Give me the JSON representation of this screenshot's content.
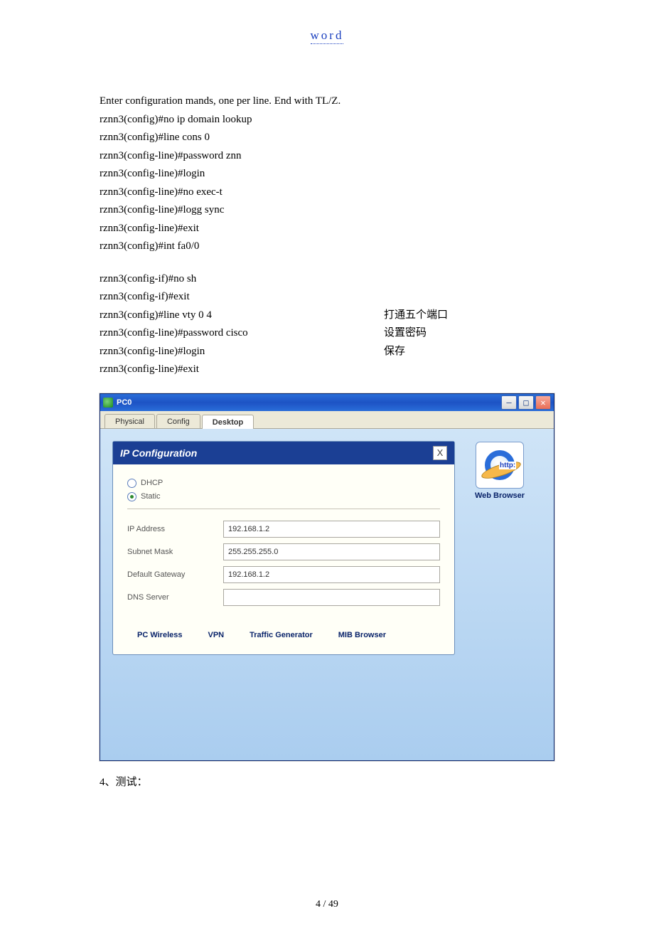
{
  "header": {
    "link_text": "word"
  },
  "cli": {
    "line1": "Enter configuration mands, one per line.    End with TL/Z.",
    "line2": "rznn3(config)#no ip domain lookup",
    "line3": "rznn3(config)#line cons 0",
    "line4": "rznn3(config-line)#password znn",
    "line5": "rznn3(config-line)#login",
    "line6": "rznn3(config-line)#no exec-t",
    "line7": "rznn3(config-line)#logg sync",
    "line8": "rznn3(config-line)#exit",
    "line9": "rznn3(config)#int fa0/0",
    "line10": "rznn3(config-if)#no sh",
    "line11": "rznn3(config-if)#exit",
    "line12": "rznn3(config)#line vty 0 4",
    "line13": "rznn3(config-line)#password cisco",
    "line14": "rznn3(config-line)#login",
    "line15": "rznn3(config-line)#exit",
    "note12": "打通五个端口",
    "note13": "设置密码",
    "note14": "保存"
  },
  "pc0": {
    "title": "PC0",
    "tabs": {
      "physical": "Physical",
      "config": "Config",
      "desktop": "Desktop"
    },
    "ipconf": {
      "title": "IP Configuration",
      "close": "X",
      "dhcp": "DHCP",
      "static": "Static",
      "ip_label": "IP Address",
      "ip_value": "192.168.1.2",
      "mask_label": "Subnet Mask",
      "mask_value": "255.255.255.0",
      "gw_label": "Default Gateway",
      "gw_value": "192.168.1.2",
      "dns_label": "DNS Server",
      "dns_value": ""
    },
    "web_browser_label": "Web Browser",
    "web_http_text": "http:",
    "tools": {
      "pc_wireless": "PC Wireless",
      "vpn": "VPN",
      "traffic": "Traffic Generator",
      "mib": "MIB Browser"
    }
  },
  "section4": "4、测试：",
  "page_number": "4  / 49"
}
